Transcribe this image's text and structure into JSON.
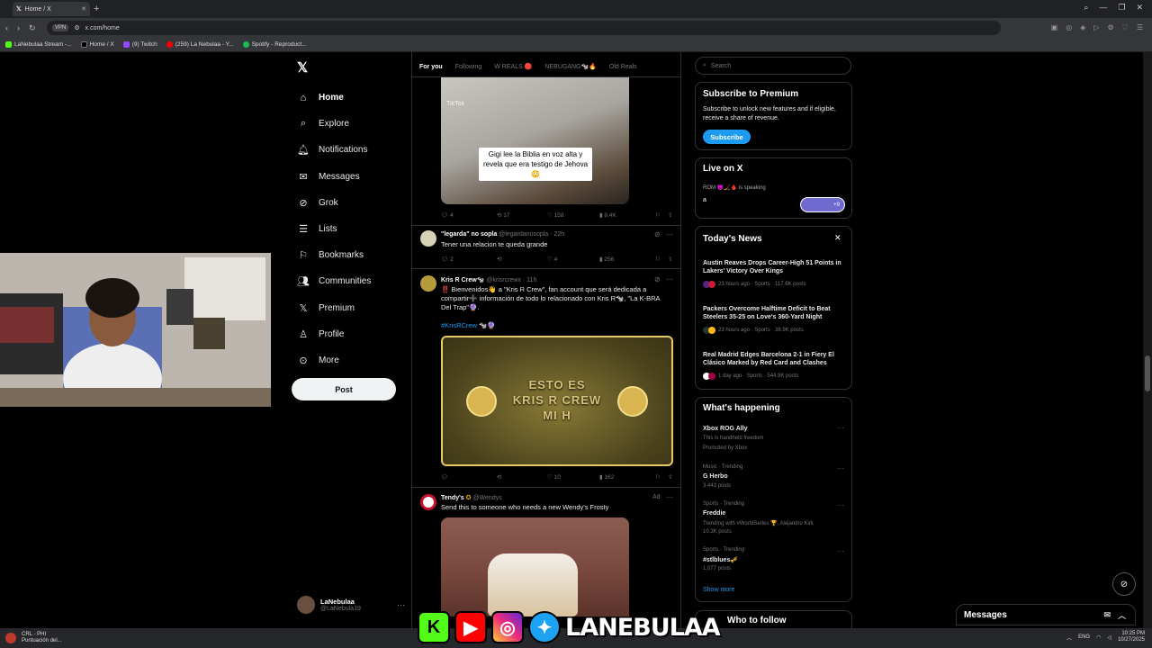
{
  "browser": {
    "tab_title": "Home / X",
    "url": "x.com/home",
    "vpn": "VPN",
    "bookmarks": [
      "LaNebulaa Stream -...",
      "Home / X",
      "(9) Twitch",
      "(259) La Nebulaa - Y...",
      "Spotify - Reproduct..."
    ]
  },
  "nav": {
    "items": [
      {
        "label": "Home",
        "icon": "home-icon"
      },
      {
        "label": "Explore",
        "icon": "search-icon"
      },
      {
        "label": "Notifications",
        "icon": "bell-icon"
      },
      {
        "label": "Messages",
        "icon": "mail-icon"
      },
      {
        "label": "Grok",
        "icon": "grok-icon"
      },
      {
        "label": "Lists",
        "icon": "list-icon"
      },
      {
        "label": "Bookmarks",
        "icon": "bookmark-icon"
      },
      {
        "label": "Communities",
        "icon": "people-icon"
      },
      {
        "label": "Premium",
        "icon": "x-icon"
      },
      {
        "label": "Profile",
        "icon": "person-icon"
      },
      {
        "label": "More",
        "icon": "more-icon"
      }
    ],
    "post_label": "Post",
    "profile_name": "LaNebulaa",
    "profile_handle": "@LaNebula19"
  },
  "feed": {
    "tabs": [
      "For you",
      "Following",
      "W REALS 🔴",
      "NEBUGANG🐄🔥",
      "Old Reals"
    ],
    "tweet1": {
      "watermark": "TikTok",
      "caption": "Gigi lee la Biblia en voz alta y revela que era testigo de Jehova 😳",
      "replies": "4",
      "reposts": "17",
      "likes": "158",
      "views": "9.4K"
    },
    "tweet2": {
      "name": "\"legarda\" no sopla",
      "handle": "@legardanosopla · 22h",
      "text": "Tener una relacion te queda grande",
      "replies": "2",
      "reposts": "",
      "likes": "4",
      "views": "256"
    },
    "tweet3": {
      "name": "Kris R Crew🐄",
      "handle": "@krisrcrewx · 11h",
      "text": "‼️ Bienvenidos👋 a \"Kris R Crew\", fan account que será dedicada a compartir➕ información de todo lo relacionado con Kris R🐄, \"La K-BRA Del Trap\"🔮.",
      "hashtag": "#KrisRCrew 🐄🔮",
      "card_line1": "ESTO ES",
      "card_line2": "KRIS R CREW",
      "card_line3": "MI H",
      "replies": "",
      "reposts": "",
      "likes": "10",
      "views": "162"
    },
    "tweet4": {
      "name": "Tendy's",
      "handle": "@Wendys",
      "ad": "Ad",
      "text": "Send this to someone who needs a new Wendy's Frosty"
    }
  },
  "right": {
    "search_placeholder": "Search",
    "premium": {
      "title": "Subscribe to Premium",
      "text": "Subscribe to unlock new features and if eligible, receive a share of revenue.",
      "button": "Subscribe"
    },
    "live": {
      "title": "Live on X",
      "host": "ROM 😈🏒🩸 is speaking",
      "line": "a",
      "count": "+9"
    },
    "news": {
      "title": "Today's News",
      "items": [
        {
          "headline": "Austin Reaves Drops Career-High 51 Points in Lakers' Victory Over Kings",
          "meta": "23 hours ago · Sports · 117.6K posts"
        },
        {
          "headline": "Packers Overcome Halftime Deficit to Beat Steelers 35-25 on Love's 360-Yard Night",
          "meta": "23 hours ago · Sports · 38.9K posts"
        },
        {
          "headline": "Real Madrid Edges Barcelona 2-1 in Fiery El Clásico Marked by Red Card and Clashes",
          "meta": "1 day ago · Sports · 544.9K posts"
        }
      ]
    },
    "happening": {
      "title": "What's happening",
      "items": [
        {
          "category": "",
          "title": "Xbox ROG Ally",
          "meta": "This is handheld freedom",
          "meta2": "Promoted by Xbox"
        },
        {
          "category": "Music · Trending",
          "title": "G Herbo",
          "meta": "3,443 posts",
          "meta2": ""
        },
        {
          "category": "Sports · Trending",
          "title": "Freddie",
          "meta": "Trending with #WorldSeries 🏆, Alejandro Kirk",
          "meta2": "10.3K posts"
        },
        {
          "category": "Sports · Trending",
          "title": "#stlblues🎺",
          "meta": "1,077 posts",
          "meta2": ""
        }
      ],
      "show_more": "Show more"
    },
    "who_to_follow": "Who to follow",
    "messages": "Messages"
  },
  "stream": {
    "brand": "LANEBULAA"
  },
  "taskbar": {
    "status": "CRL - PHI",
    "status2": "Puntuación del...",
    "lang": "ENG",
    "time": "10:25 PM",
    "date": "10/27/2025"
  }
}
